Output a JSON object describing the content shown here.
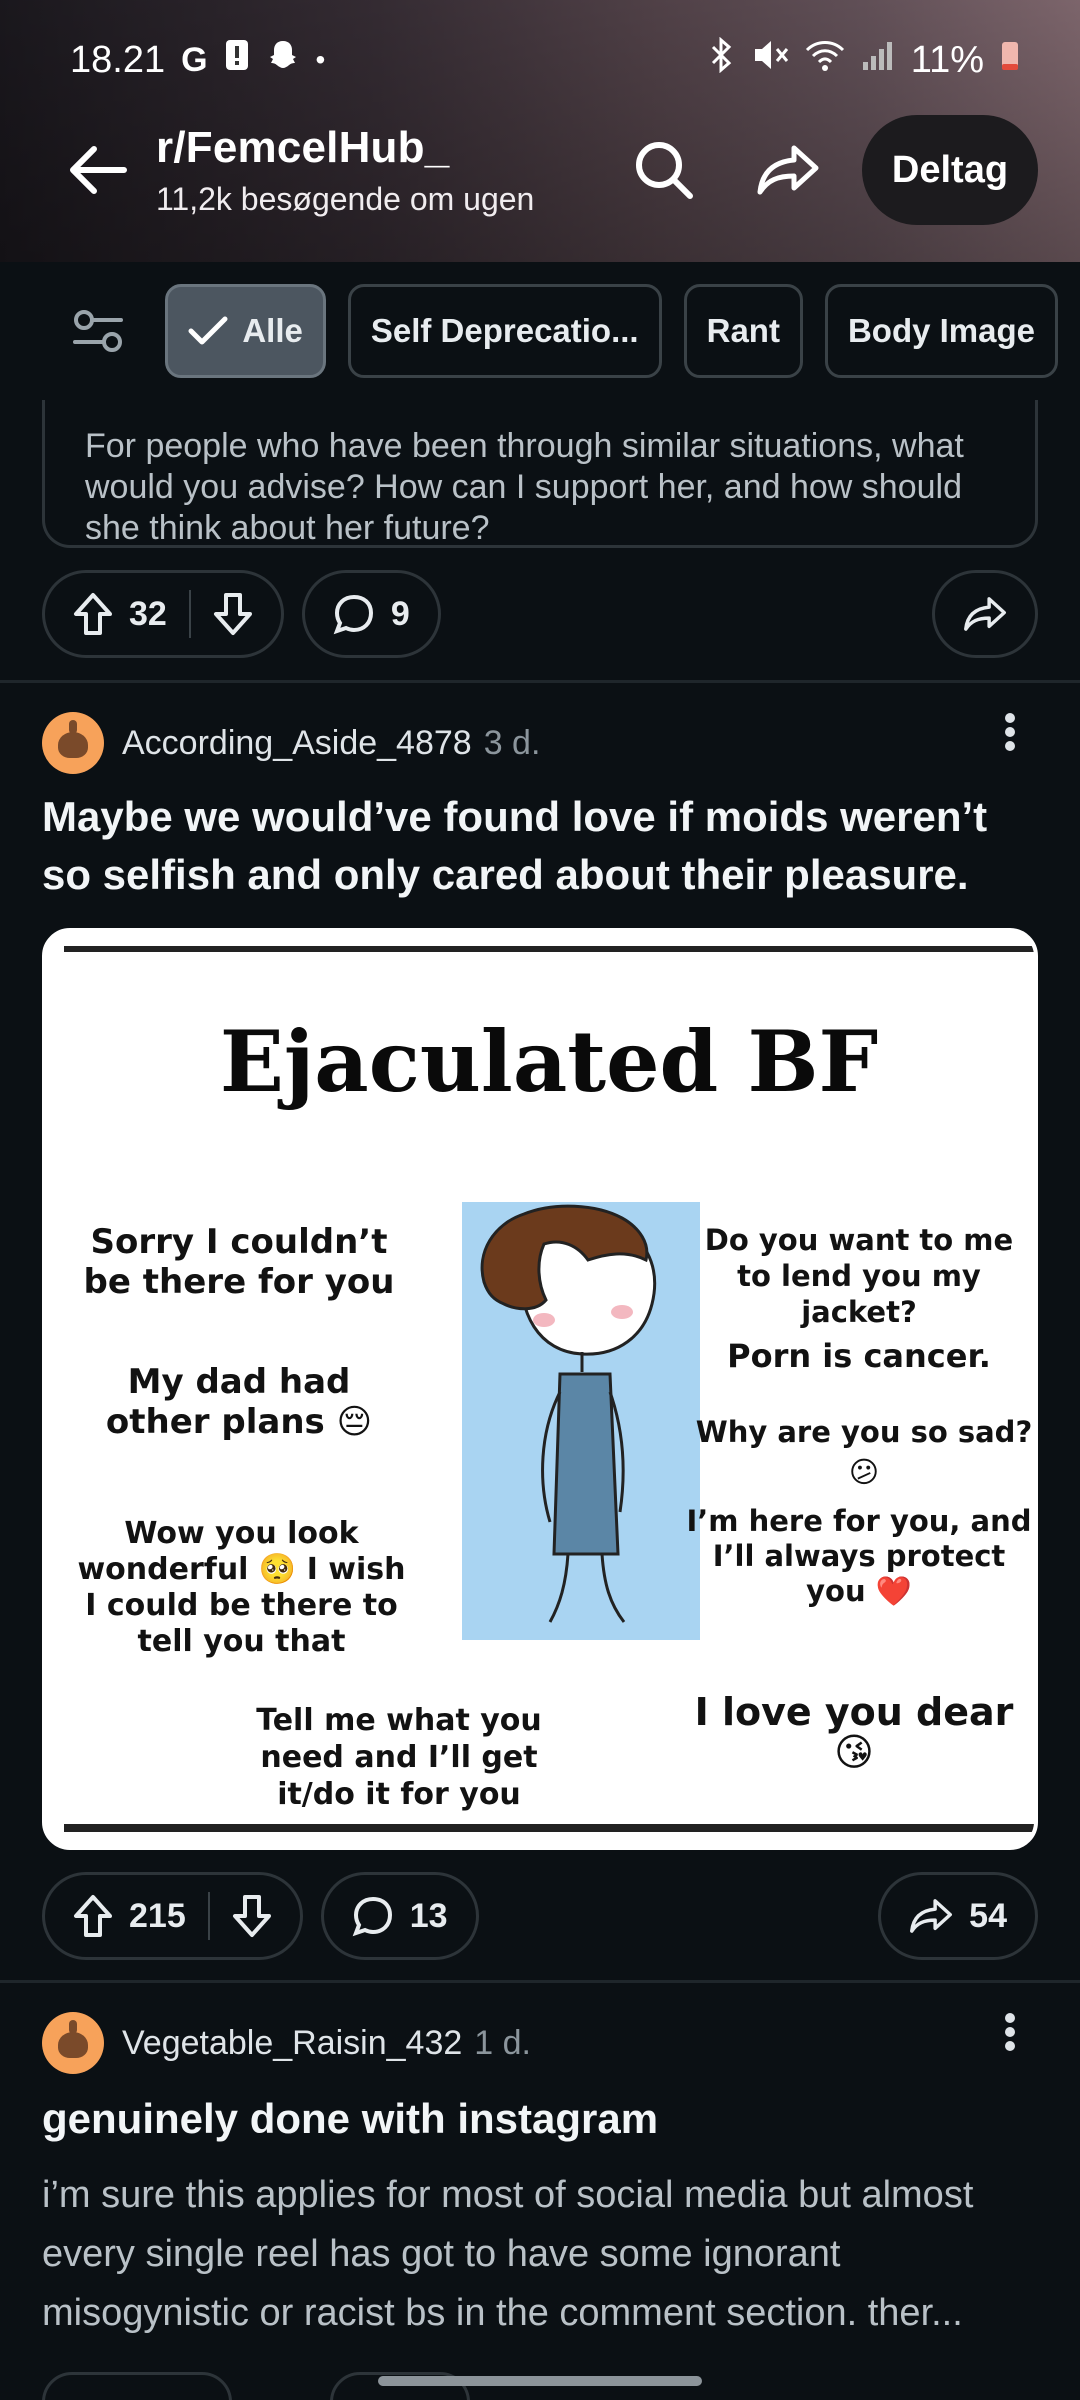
{
  "status_bar": {
    "time": "18.21",
    "battery": "11%"
  },
  "header": {
    "subreddit": "r/FemcelHub_",
    "visitors": "11,2k besøgende om ugen",
    "join_label": "Deltag"
  },
  "filters": {
    "chips": [
      {
        "label": "Alle",
        "active": true
      },
      {
        "label": "Self Deprecatio...",
        "active": false
      },
      {
        "label": "Rant",
        "active": false
      },
      {
        "label": "Body Image",
        "active": false
      }
    ]
  },
  "prev_post": {
    "text": "For people who have been through similar situations, what would you advise? How can I support her, and how should she think about her future?",
    "upvotes": "32",
    "comments": "9"
  },
  "post1": {
    "author": "According_Aside_4878",
    "age": "3 d.",
    "title": "Maybe we would’ve found love if moids weren’t so selfish and only cared about their pleasure.",
    "image": {
      "title": "Ejaculated BF",
      "left1": "Sorry I couldn’t be there for you",
      "left2": "My dad had other plans 😔",
      "left3": "Wow you look wonderful 🥺 I wish I could be there to tell you that",
      "bottom": "Tell me what you need and I’ll get it/do it for you",
      "right1": "Do you want to me to lend you my jacket?",
      "right2": "Porn is cancer.",
      "right3": "Why are you so sad? 😕",
      "right4": "I’m here for you, and I’ll always protect you ❤️",
      "right5": "I love you dear 😘"
    },
    "upvotes": "215",
    "comments": "13",
    "shares": "54"
  },
  "post2": {
    "author": "Vegetable_Raisin_432",
    "age": "1 d.",
    "title": "genuinely done with instagram",
    "body": "i’m sure this applies for most of social media but almost every single reel has got to have some ignorant misogynistic or racist bs in the comment section. ther..."
  }
}
